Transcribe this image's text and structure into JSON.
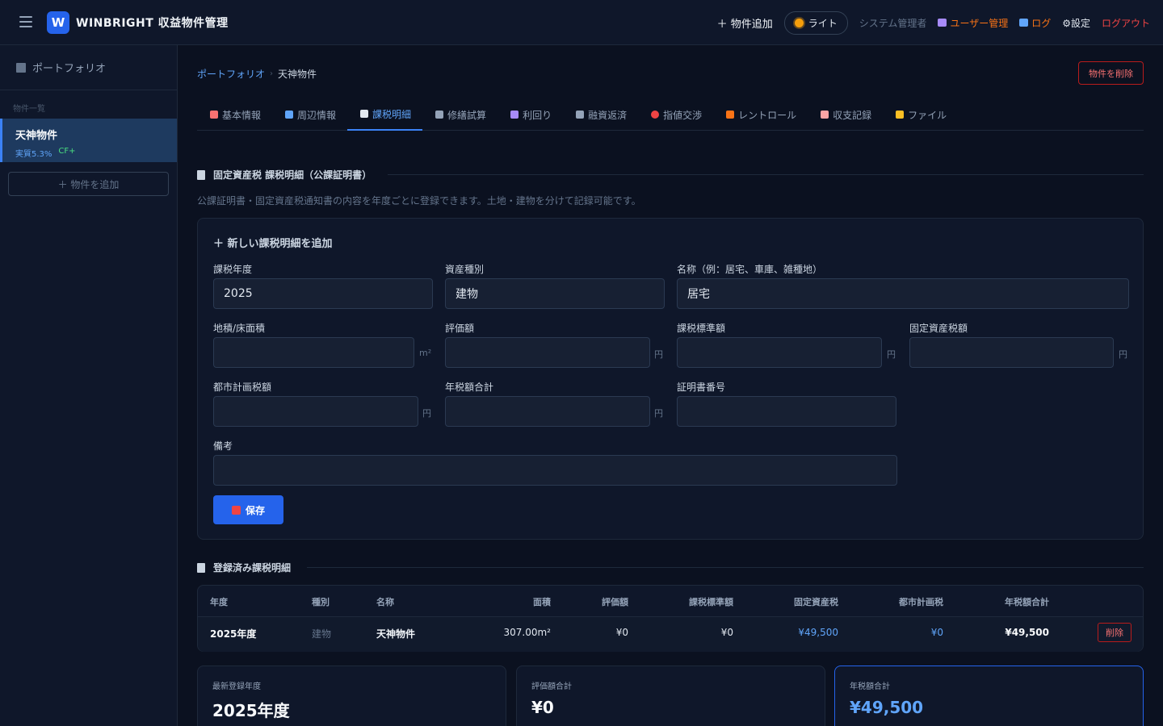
{
  "header": {
    "title": "WINBRIGHT 収益物件管理",
    "logo_letter": "W",
    "add_property": "＋ 物件追加",
    "theme_label": "ライト",
    "role": "システム管理者",
    "user_mgmt": "ユーザー管理",
    "log": "ログ",
    "settings": "⚙設定",
    "logout": "ログアウト"
  },
  "sidebar": {
    "title": "ポートフォリオ",
    "section_label": "物件一覧",
    "items": [
      {
        "name": "天神物件",
        "yield": "実質5.3%",
        "cf": "CF+"
      }
    ],
    "add_label": "＋ 物件を追加"
  },
  "breadcrumb": {
    "root": "ポートフォリオ",
    "sep": "›",
    "current": "天神物件"
  },
  "delete_property": "物件を削除",
  "tabs": [
    {
      "label": "基本情報",
      "icon": "clipboard-icon",
      "color": "#f87171"
    },
    {
      "label": "周辺情報",
      "icon": "map-icon",
      "color": "#60a5fa"
    },
    {
      "label": "課税明細",
      "icon": "receipt-icon",
      "color": "#e2e8f0"
    },
    {
      "label": "修繕試算",
      "icon": "hammer-icon",
      "color": "#94a3b8"
    },
    {
      "label": "利回り",
      "icon": "chart-icon",
      "color": "#a78bfa"
    },
    {
      "label": "融資返済",
      "icon": "bank-icon",
      "color": "#94a3b8"
    },
    {
      "label": "指値交渉",
      "icon": "target-icon",
      "color": "#ef4444"
    },
    {
      "label": "レントロール",
      "icon": "house-icon",
      "color": "#f97316"
    },
    {
      "label": "収支記録",
      "icon": "document-icon",
      "color": "#fca5a5"
    },
    {
      "label": "ファイル",
      "icon": "folder-icon",
      "color": "#fbbf24"
    }
  ],
  "tax_section": {
    "title": "固定資産税 課税明細（公課証明書）",
    "description": "公課証明書・固定資産税通知書の内容を年度ごとに登録できます。土地・建物を分けて記録可能です。"
  },
  "form": {
    "title": "＋ 新しい課税明細を追加",
    "tax_year": {
      "label": "課税年度",
      "value": "2025"
    },
    "asset_type": {
      "label": "資産種別",
      "value": "建物"
    },
    "name": {
      "label": "名称（例：居宅、車庫、雑種地）",
      "value": "居宅"
    },
    "area": {
      "label": "地積/床面積",
      "value": "",
      "unit": "m²"
    },
    "assessed": {
      "label": "評価額",
      "value": "",
      "unit": "円"
    },
    "tax_base": {
      "label": "課税標準額",
      "value": "",
      "unit": "円"
    },
    "property_tax": {
      "label": "固定資産税額",
      "value": "",
      "unit": "円"
    },
    "city_tax": {
      "label": "都市計画税額",
      "value": "",
      "unit": "円"
    },
    "annual_total": {
      "label": "年税額合計",
      "value": "",
      "unit": "円"
    },
    "cert_no": {
      "label": "証明書番号",
      "value": ""
    },
    "notes": {
      "label": "備考",
      "value": ""
    },
    "save_label": "保存"
  },
  "registered": {
    "title": "登録済み課税明細",
    "columns": [
      "年度",
      "種別",
      "名称",
      "面積",
      "評価額",
      "課税標準額",
      "固定資産税",
      "都市計画税",
      "年税額合計"
    ],
    "rows": [
      {
        "year": "2025年度",
        "type": "建物",
        "name": "天神物件",
        "area": "307.00m²",
        "assessed": "¥0",
        "tax_base": "¥0",
        "property_tax": "¥49,500",
        "city_tax": "¥0",
        "total": "¥49,500",
        "delete": "削除"
      }
    ]
  },
  "stats": [
    {
      "label": "最新登録年度",
      "value": "2025年度"
    },
    {
      "label": "評価額合計",
      "value": "¥0"
    },
    {
      "label": "年税額合計",
      "value": "¥49,500"
    }
  ],
  "colors": {
    "accent": "#2563eb",
    "background": "#0b1120",
    "danger": "#ef4444",
    "link": "#60a5fa"
  }
}
